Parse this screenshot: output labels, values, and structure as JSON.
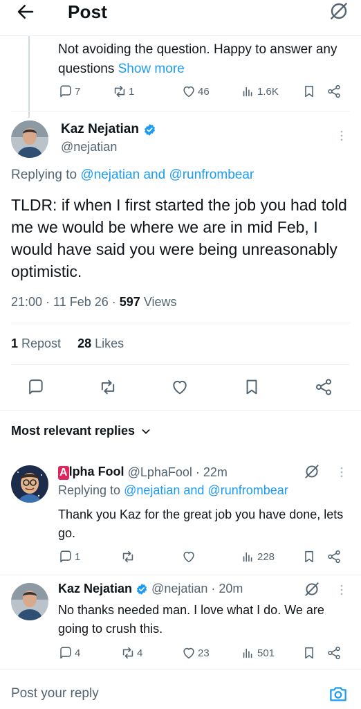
{
  "header": {
    "title": "Post"
  },
  "previous_post": {
    "text": "Not avoiding the question.  Happy to answer any questions ",
    "show_more": "Show more",
    "replies": "7",
    "reposts": "1",
    "likes": "46",
    "views": "1.6K"
  },
  "main_post": {
    "author_name": "Kaz Nejatian",
    "author_handle": "@nejatian",
    "replying_prefix": "Replying to ",
    "replying_to": "@nejatian and @runfrombear",
    "text": "TLDR: if when I first started the job you had told me we would be where we are in mid Feb, I would have said you were being unreasonably optimistic.",
    "time": "21:00 · 11 Feb 26 · ",
    "views_count": "597",
    "views_label": " Views",
    "repost_count": "1",
    "repost_label": " Repost",
    "likes_count": "28",
    "likes_label": " Likes"
  },
  "replies_section": {
    "label": "Most relevant replies"
  },
  "replies": [
    {
      "badge": "A",
      "name": "lpha Fool",
      "handle_time": "@LphaFool · 22m",
      "replying_prefix": "Replying to ",
      "replying_to": "@nejatian and @runfrombear",
      "text": "Thank you Kaz for the great job you have done, lets go.",
      "replies": "1",
      "reposts": "",
      "likes": "",
      "views": "228"
    },
    {
      "name": "Kaz Nejatian",
      "handle_time": "@nejatian · 20m",
      "text": "No thanks needed man.  I love what I do.  We are going to crush this.",
      "replies": "4",
      "reposts": "4",
      "likes": "23",
      "views": "501"
    }
  ],
  "composer": {
    "placeholder": "Post your reply"
  },
  "colors": {
    "accent": "#1d9bf0",
    "muted": "#536471",
    "text": "#0f1419",
    "badge_red": "#e0245e"
  }
}
